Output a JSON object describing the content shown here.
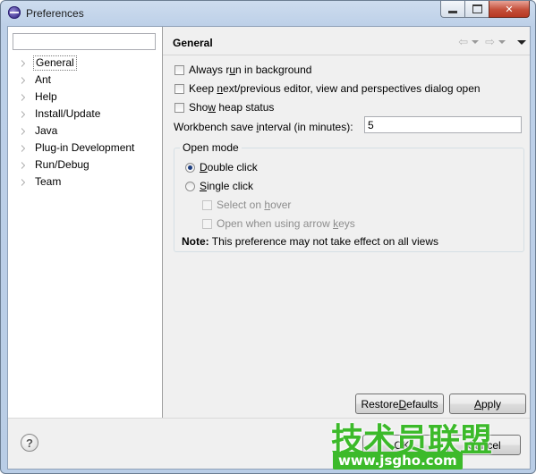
{
  "window": {
    "title": "Preferences",
    "min_icon": "minimize-icon",
    "max_icon": "maximize-icon",
    "close_glyph": "✕"
  },
  "sidebar": {
    "filter_value": "",
    "items": [
      {
        "label": "General",
        "selected": true
      },
      {
        "label": "Ant"
      },
      {
        "label": "Help"
      },
      {
        "label": "Install/Update"
      },
      {
        "label": "Java"
      },
      {
        "label": "Plug-in Development"
      },
      {
        "label": "Run/Debug"
      },
      {
        "label": "Team"
      }
    ]
  },
  "page": {
    "title": "General",
    "nav": {
      "back": "⇦",
      "forward": "⇨"
    },
    "options": {
      "always_run": {
        "pre": "Always r",
        "key": "u",
        "post": "n in background",
        "checked": false
      },
      "keep_next": {
        "pre": "Keep ",
        "key": "n",
        "post": "ext/previous editor, view and perspectives dialog open",
        "checked": false
      },
      "show_heap": {
        "pre": "Sho",
        "key": "w",
        "post": " heap status",
        "checked": false
      }
    },
    "interval": {
      "pre": "Workbench save ",
      "key": "i",
      "post": "nterval (in minutes):",
      "value": "5"
    },
    "open_mode": {
      "title": "Open mode",
      "double": {
        "pre": "",
        "key": "D",
        "post": "ouble click",
        "selected": true
      },
      "single": {
        "pre": "",
        "key": "S",
        "post": "ingle click",
        "selected": false
      },
      "select_hover": {
        "pre": "Select on ",
        "key": "h",
        "post": "over",
        "enabled": false
      },
      "arrow_keys": {
        "pre": "Open when using arrow ",
        "key": "k",
        "post": "eys",
        "enabled": false
      },
      "note_bold": "Note:",
      "note_text": " This preference may not take effect on all views"
    }
  },
  "buttons": {
    "restore": {
      "pre": "Restore ",
      "key": "D",
      "post": "efaults"
    },
    "apply": {
      "pre": "",
      "key": "A",
      "post": "pply"
    },
    "ok": "OK",
    "cancel": "Cancel"
  },
  "help_glyph": "?",
  "watermark": {
    "cn": "技术员联盟",
    "url": "www.jsgho.com"
  },
  "colors": {
    "watermark_green": "#3cba2a",
    "close_red": "#c44f3a"
  }
}
